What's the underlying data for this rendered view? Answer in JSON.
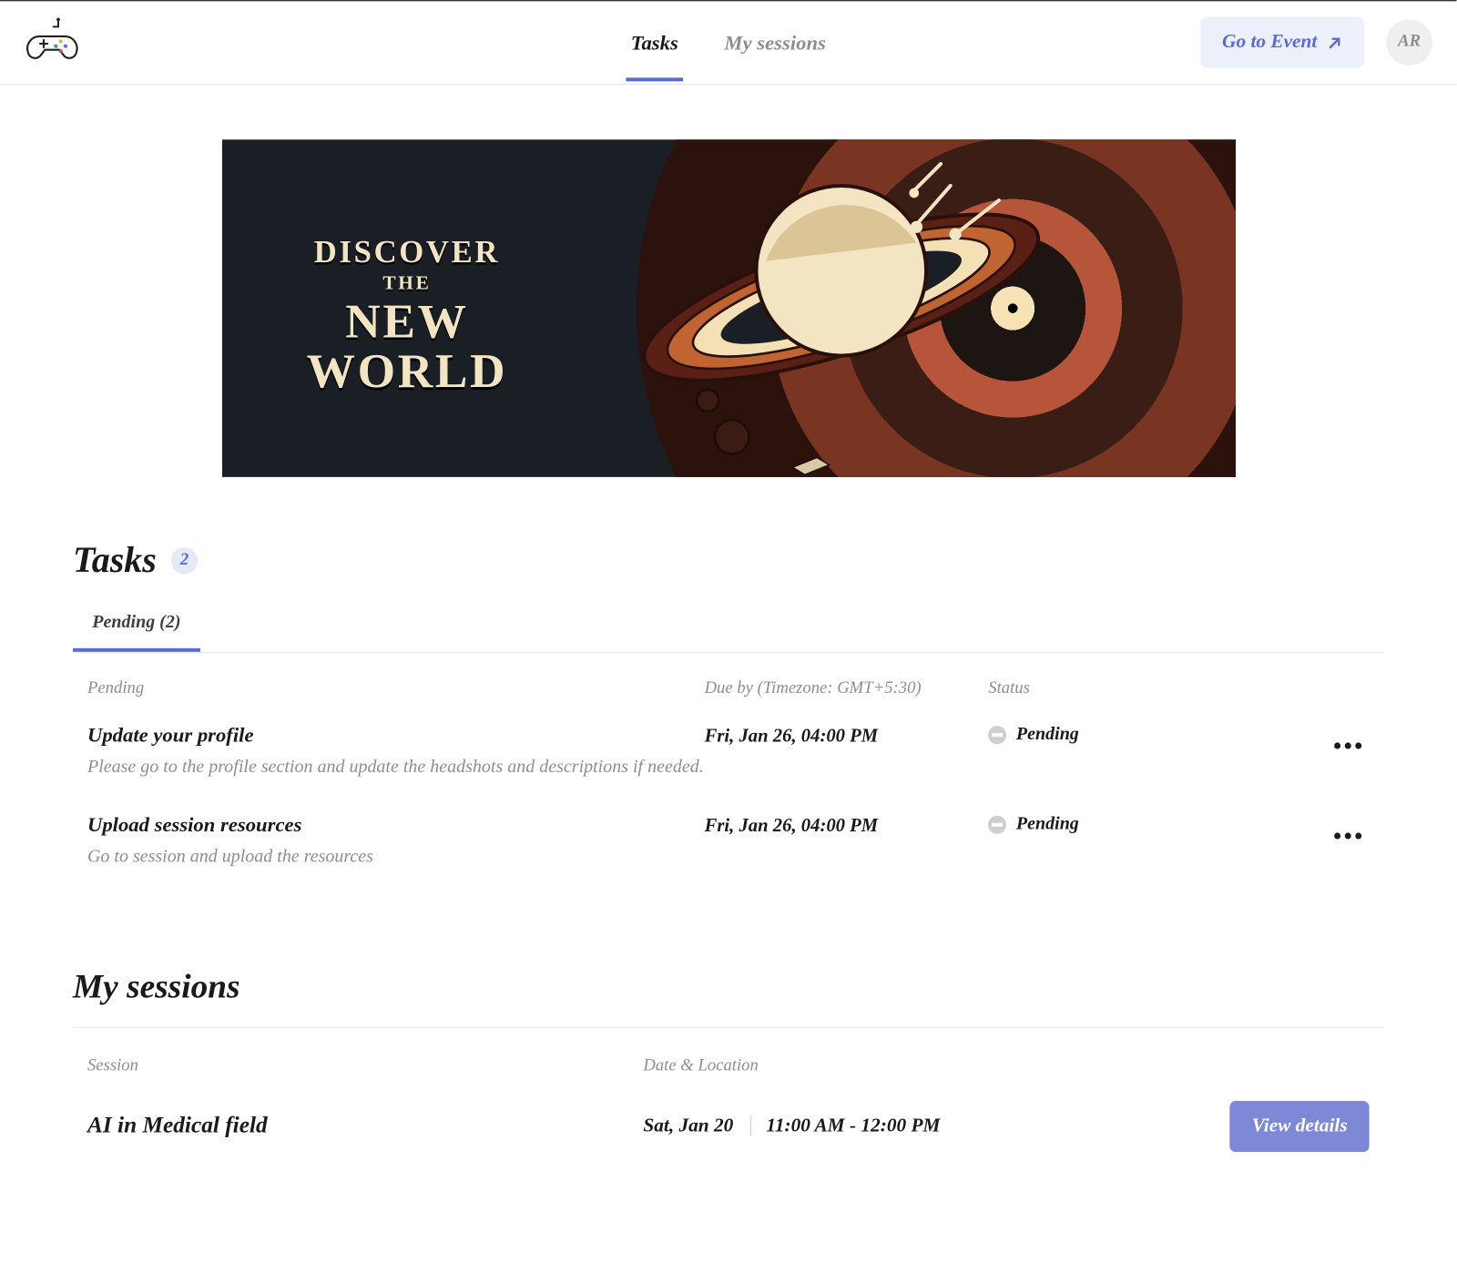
{
  "nav": {
    "tabs": [
      {
        "label": "Tasks",
        "active": true
      },
      {
        "label": "My sessions",
        "active": false
      }
    ],
    "go_to_event": "Go to Event",
    "avatar_initials": "AR"
  },
  "banner": {
    "line1": "DISCOVER",
    "line2": "THE",
    "line3": "NEW",
    "line4": "WORLD"
  },
  "tasks": {
    "heading": "Tasks",
    "count": "2",
    "subtabs": [
      {
        "label": "Pending (2)",
        "active": true
      }
    ],
    "columns": {
      "pending": "Pending",
      "due": "Due by (Timezone: GMT+5:30)",
      "status": "Status"
    },
    "rows": [
      {
        "title": "Update your profile",
        "desc": "Please go to the profile section and update the headshots and descriptions if needed.",
        "due": "Fri, Jan 26, 04:00 PM",
        "status": "Pending"
      },
      {
        "title": "Upload session resources",
        "desc": "Go to session and upload the resources",
        "due": "Fri, Jan 26, 04:00 PM",
        "status": "Pending"
      }
    ]
  },
  "sessions": {
    "heading": "My sessions",
    "columns": {
      "session": "Session",
      "datetime": "Date & Location"
    },
    "rows": [
      {
        "title": "AI in Medical field",
        "date": "Sat, Jan 20",
        "time": "11:00 AM - 12:00 PM",
        "cta": "View details"
      }
    ]
  }
}
